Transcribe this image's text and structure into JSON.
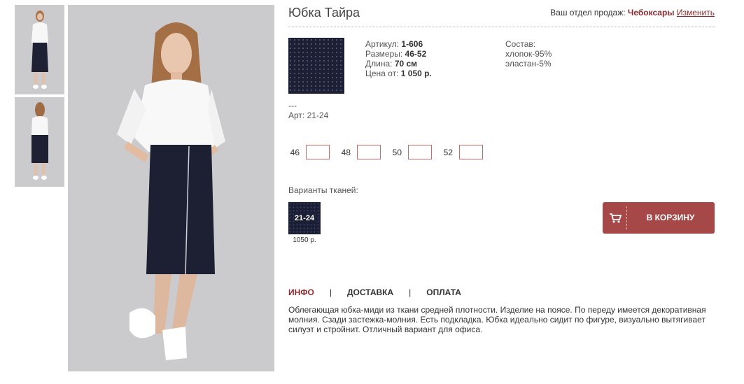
{
  "product": {
    "title": "Юбка Тайра",
    "region_label": "Ваш отдел продаж:",
    "region_city": "Чебоксары",
    "region_change": "Изменить"
  },
  "specs": {
    "article_label": "Артикул:",
    "article": "1-606",
    "sizes_label": "Размеры:",
    "sizes": "46-52",
    "length_label": "Длина:",
    "length": "70 см",
    "price_label": "Цена от:",
    "price": "1 050 р."
  },
  "composition": {
    "label": "Состав:",
    "items": [
      "хлопок-95%",
      "эластан-5%"
    ]
  },
  "variant_info": {
    "dashes": "---",
    "art": "Арт: 21-24"
  },
  "sizes": [
    "46",
    "48",
    "50",
    "52"
  ],
  "fabrics": {
    "label": "Варианты тканей:",
    "items": [
      {
        "code": "21-24",
        "price": "1050 р."
      }
    ]
  },
  "cart": {
    "label": "В КОРЗИНУ"
  },
  "tabs": [
    "ИНФО",
    "ДОСТАВКА",
    "ОПЛАТА"
  ],
  "description": "Облегающая юбка-миди из ткани средней плотности. Изделие на поясе. По переду имеется декоративная молния. Сзади застежка-молния. Есть подкладка. Юбка идеально сидит по фигуре, визуально вытягивает силуэт и стройнит. Отличный вариант для офиса.",
  "colors": {
    "accent": "#8b2b2e",
    "button": "#a74848",
    "fabric": "#1b1f35"
  }
}
